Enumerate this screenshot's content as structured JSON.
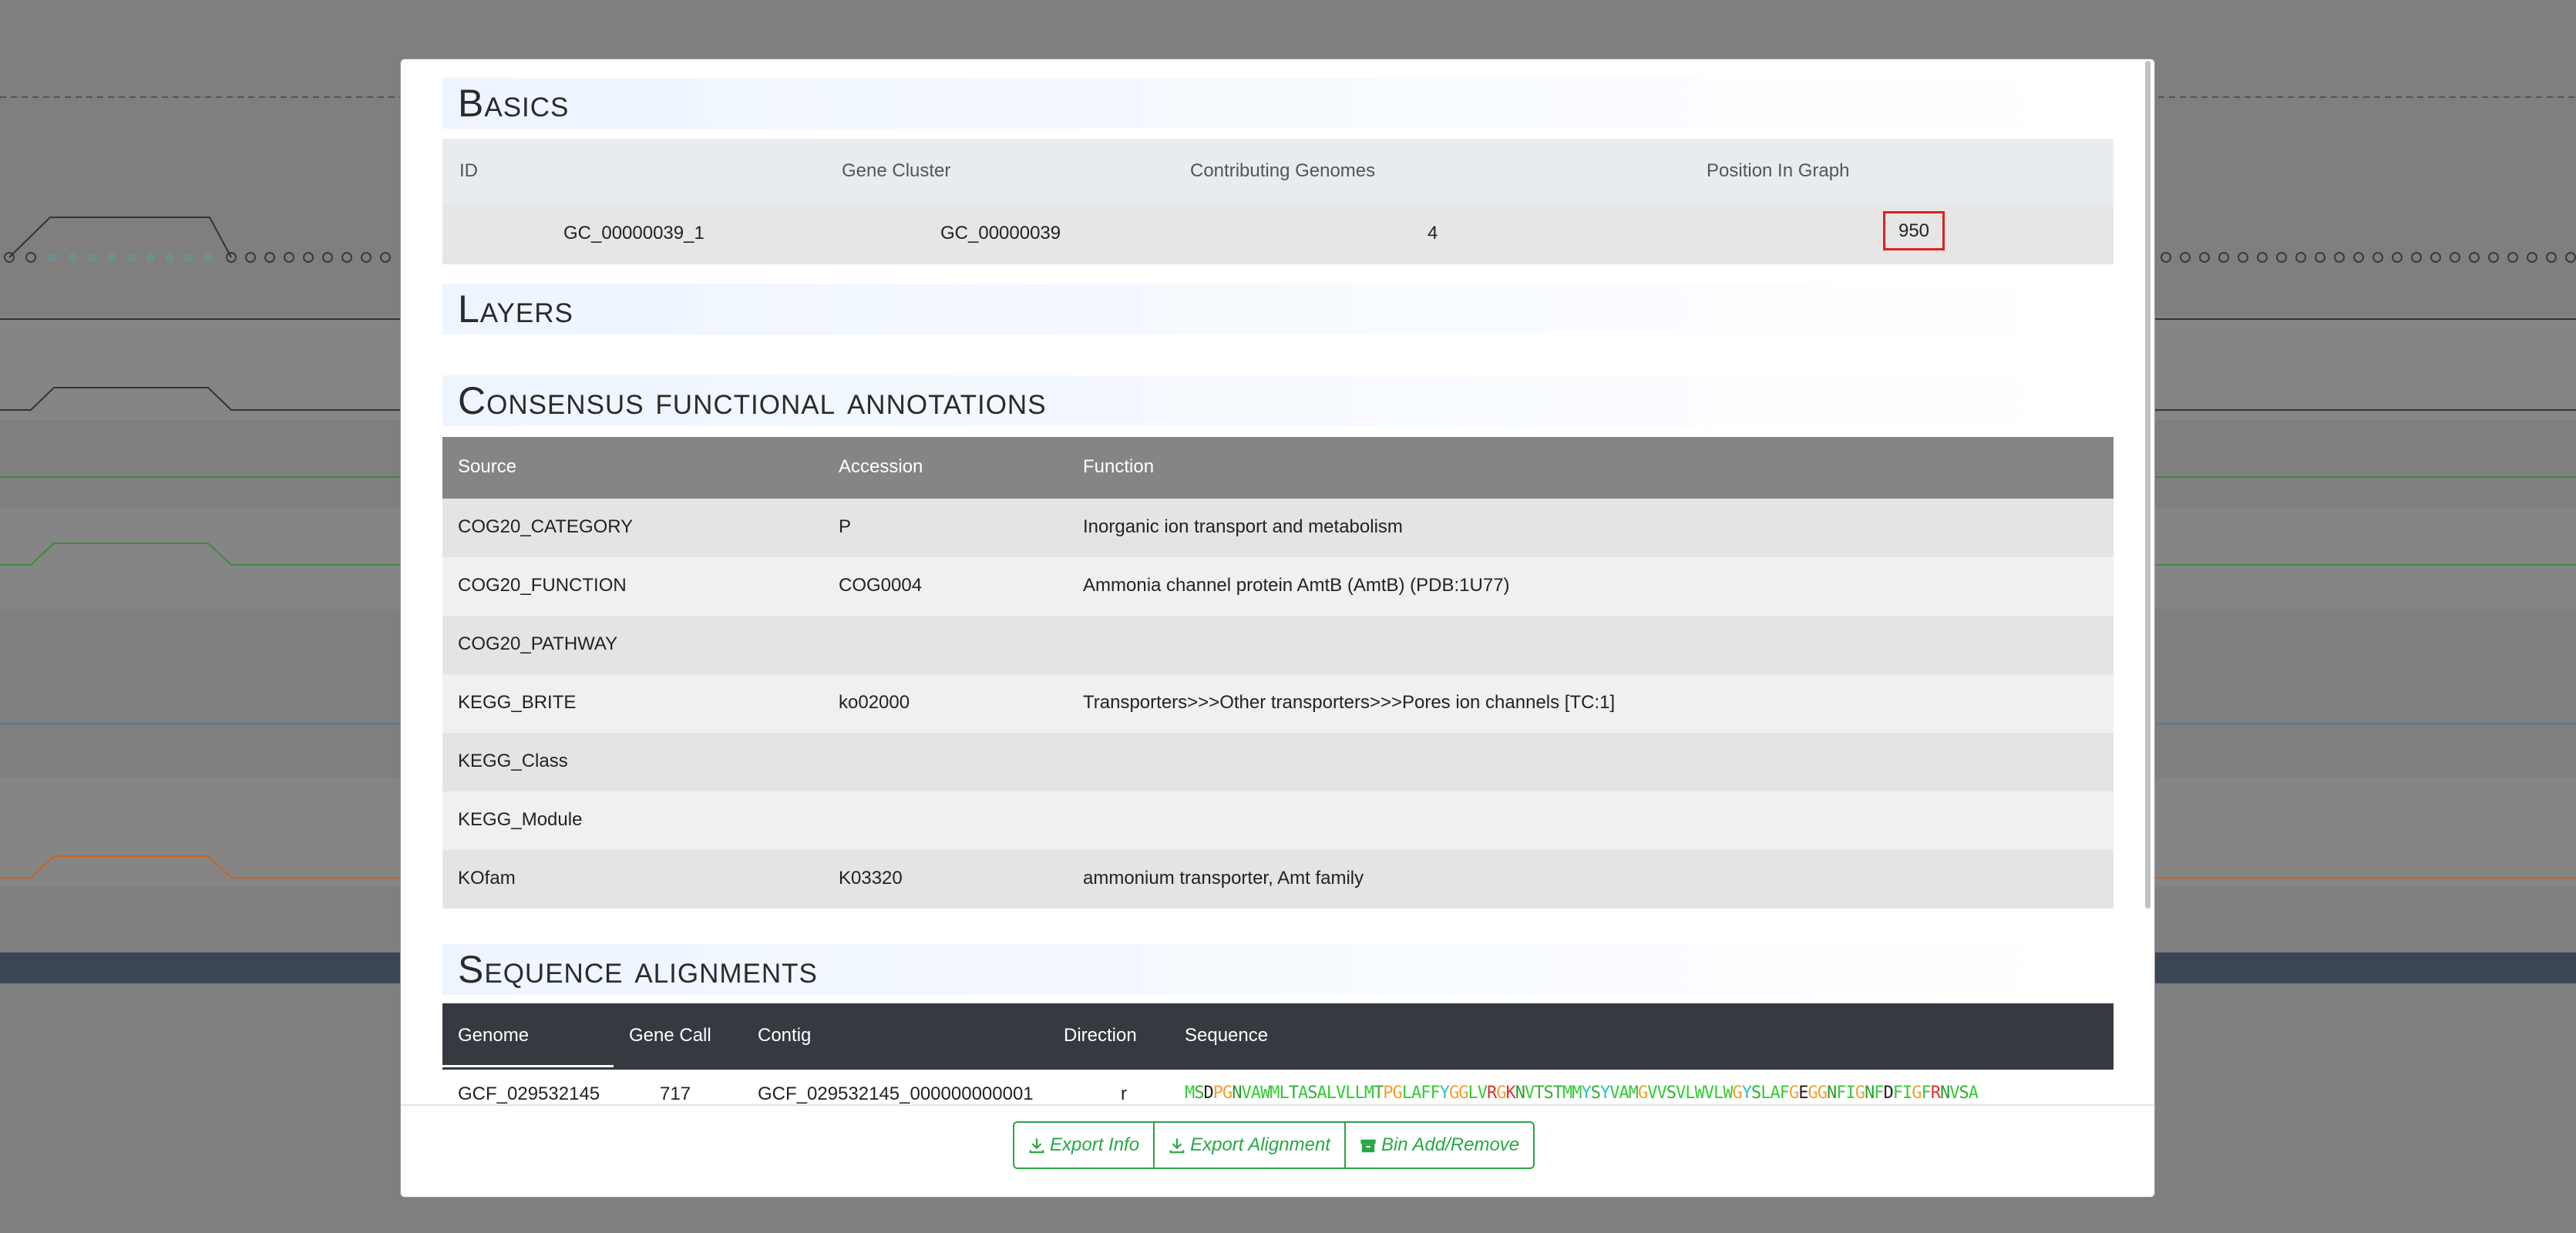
{
  "basics": {
    "title": "Basics",
    "headers": [
      "ID",
      "Gene Cluster",
      "Contributing Genomes",
      "Position In Graph"
    ],
    "row": {
      "id": "GC_00000039_1",
      "gene_cluster": "GC_00000039",
      "genomes": "4",
      "position": "950"
    }
  },
  "layers": {
    "title": "Layers"
  },
  "consensus": {
    "title": "Consensus functional annotations",
    "headers": [
      "Source",
      "Accession",
      "Function"
    ],
    "rows": [
      {
        "source": "COG20_CATEGORY",
        "accession": "P",
        "function": "Inorganic ion transport and metabolism"
      },
      {
        "source": "COG20_FUNCTION",
        "accession": "COG0004",
        "function": "Ammonia channel protein AmtB (AmtB) (PDB:1U77)"
      },
      {
        "source": "COG20_PATHWAY",
        "accession": "",
        "function": ""
      },
      {
        "source": "KEGG_BRITE",
        "accession": "ko02000",
        "function": "Transporters>>>Other transporters>>>Pores ion channels [TC:1]"
      },
      {
        "source": "KEGG_Class",
        "accession": "",
        "function": ""
      },
      {
        "source": "KEGG_Module",
        "accession": "",
        "function": ""
      },
      {
        "source": "KOfam",
        "accession": "K03320",
        "function": "ammonium transporter, Amt family"
      }
    ]
  },
  "alignments": {
    "title": "Sequence alignments",
    "headers": [
      "Genome",
      "Gene Call",
      "Contig",
      "Direction",
      "Sequence"
    ],
    "row": {
      "genome": "GCF_029532145",
      "gene_call": "717",
      "contig": "GCF_029532145_000000000001",
      "direction": "r",
      "sequence": "MSDPGNVAWMLTASALVLLMTPGLAFFYGGLVRGKNVTSTMMYSYVAMGVVSVLWVLWGYSLAFGEGGNFIGNFDFIGFRNVSA"
    }
  },
  "footer": {
    "export_info": "Export Info",
    "export_alignment": "Export Alignment",
    "bin": "Bin Add/Remove"
  },
  "colors": {
    "accent_green": "#28a745",
    "highlight_red": "#e02020",
    "dark_header": "#343a40",
    "gray_header": "#858585"
  }
}
